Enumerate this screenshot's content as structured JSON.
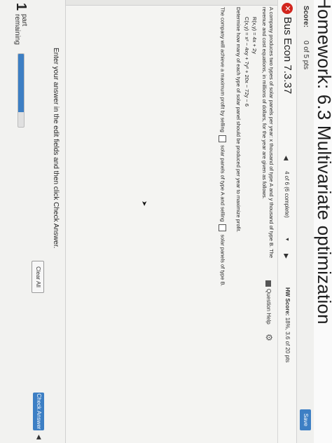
{
  "header": {
    "title": "Homework: 6.3 Multivariate optimization"
  },
  "score": {
    "label": "Score:",
    "value": "0 of 5 pts",
    "save_label": "Save"
  },
  "question": {
    "id": "Bus Econ 7.3.37",
    "nav_text": "4 of 6 (6 complete)",
    "hw_score_label": "HW Score:",
    "hw_score_value": "18%, 3.6 of 20 pts",
    "help_label": "Question Help"
  },
  "problem": {
    "intro": "A company produces two types of solar panels per year: x thousand of type A and y thousand of type B. The revenue and cost equations, in millions of dollars, for the year are given as follows.",
    "revenue": "R(x,y) = 4x + 2y",
    "cost": "C(x,y) = x² − 4xy + 7y² + 20x − 72y − 6",
    "tail": "The revenue and cost equations, in millions of dollars, for the",
    "determine": "Determine how many of each type of solar panel should be produced per year to maximize profit.",
    "answer_prefix": "The company will achieve a maximum profit by selling",
    "answer_middle": "solar panels of type A and selling",
    "answer_suffix": "solar panels of type B."
  },
  "footer": {
    "instruction": "Enter your answer in the edit fields and then click Check Answer.",
    "clear_label": "Clear All",
    "check_label": "Check Answer",
    "parts_count": "1",
    "parts_label_1": "part",
    "parts_label_2": "remaining",
    "progress_fraction": 0.8
  },
  "colors": {
    "accent": "#3d7fc4",
    "error": "#d2261e"
  }
}
